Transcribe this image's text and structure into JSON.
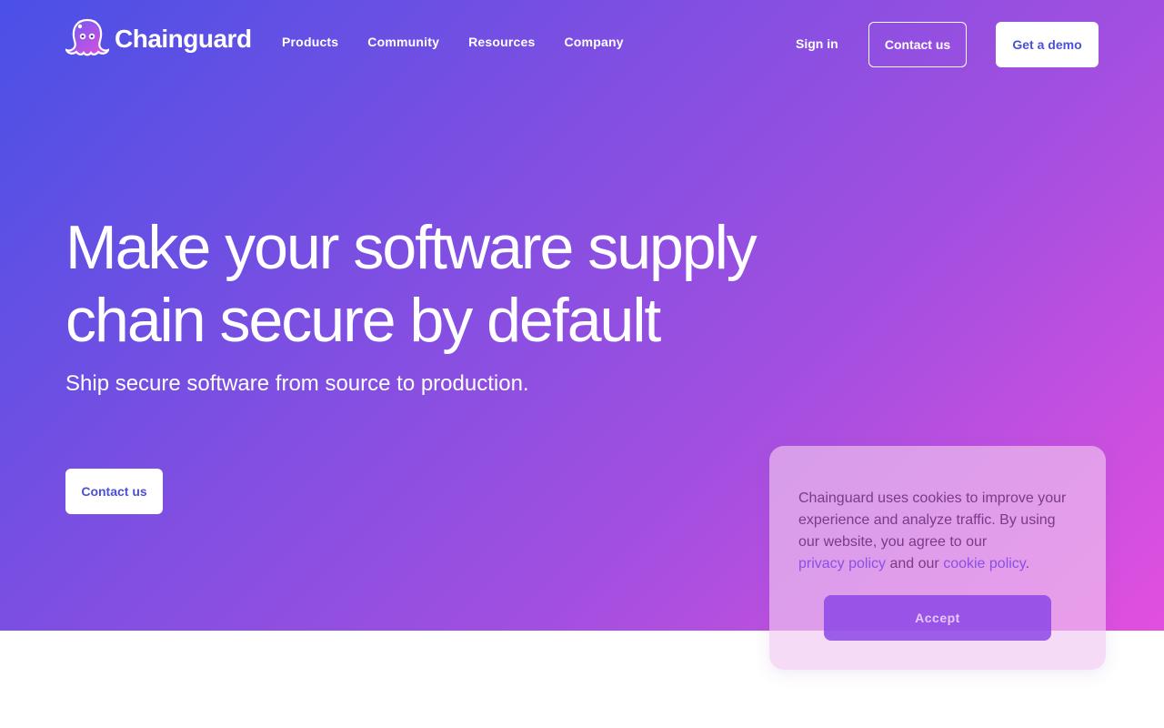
{
  "brand": {
    "name": "Chainguard"
  },
  "nav": {
    "links": [
      "Products",
      "Community",
      "Resources",
      "Company"
    ],
    "signin_label": "Sign in",
    "contact_label": "Contact us",
    "demo_label": "Get a demo"
  },
  "hero": {
    "headline_line1": "Make your software supply",
    "headline_line2": "chain secure by default",
    "subhead": "Ship secure software from source to production.",
    "cta_label": "Contact us"
  },
  "cookie": {
    "text": "Chainguard uses cookies to improve your experience and analyze traffic. By using our website, you agree to our",
    "privacy_link": "privacy policy",
    "and_text": "and our",
    "cookie_link": "cookie policy",
    "period": ".",
    "accept_label": "Accept"
  },
  "colors": {
    "gradient_start": "#4a50e6",
    "gradient_end": "#e24fdf",
    "button_text": "#4a50d8"
  }
}
